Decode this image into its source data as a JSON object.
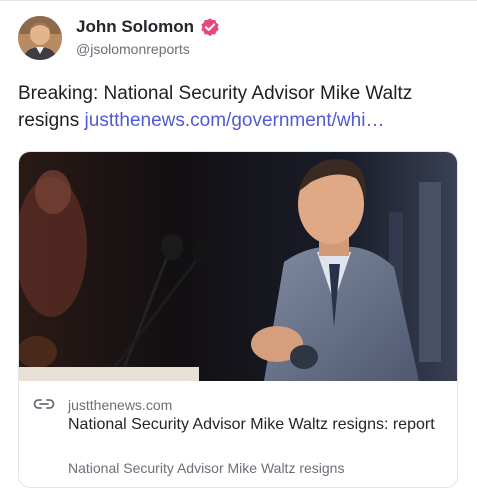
{
  "post": {
    "author": {
      "display_name": "John Solomon",
      "handle": "@jsolomonreports",
      "verified": true,
      "verified_color": "#e8467c"
    },
    "text": "Breaking: National Security Advisor Mike Waltz resigns",
    "link_text": "justthenews.com/government/whi…",
    "link_color": "#4f5bd5"
  },
  "link_card": {
    "domain": "justthenews.com",
    "title": "National Security Advisor Mike Waltz resigns: report",
    "description": "National Security Advisor Mike Waltz resigns",
    "icon": "link-icon"
  }
}
